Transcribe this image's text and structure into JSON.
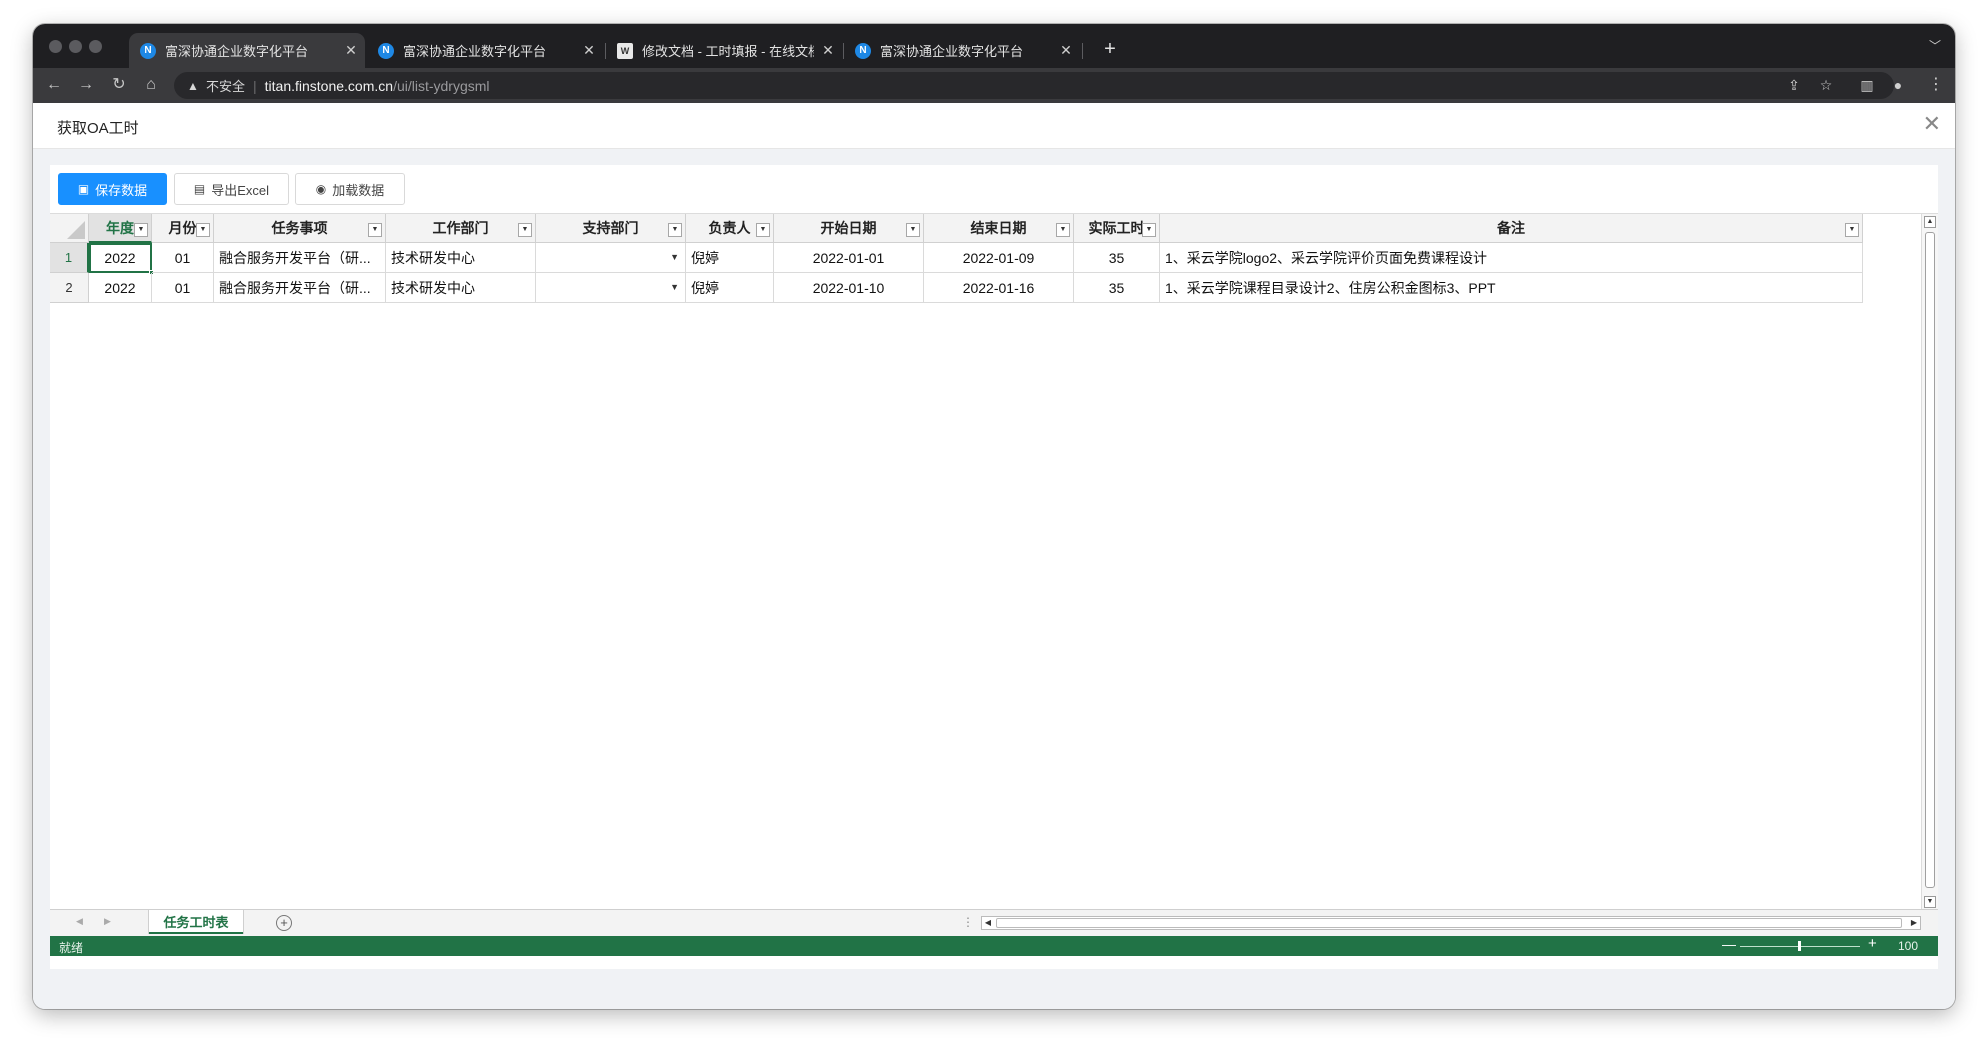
{
  "browser": {
    "tabs": [
      {
        "title": "富深协通企业数字化平台",
        "icon": "N",
        "active": true
      },
      {
        "title": "富深协通企业数字化平台",
        "icon": "N",
        "active": false
      },
      {
        "title": "修改文档 - 工时填报 - 在线文档编辑",
        "icon": "doc",
        "active": false
      },
      {
        "title": "富深协通企业数字化平台",
        "icon": "N",
        "active": false
      }
    ],
    "security_label": "不安全",
    "url_host": "titan.finstone.com.cn",
    "url_path": "/ui/list-ydrygsml"
  },
  "dialog": {
    "title": "获取OA工时"
  },
  "toolbar": {
    "save_label": "保存数据",
    "export_label": "导出Excel",
    "load_label": "加载数据"
  },
  "sheet": {
    "columns": [
      "年度",
      "月份",
      "任务事项",
      "工作部门",
      "支持部门",
      "负责人",
      "开始日期",
      "结束日期",
      "实际工时",
      "备注"
    ],
    "rows": [
      {
        "num": "1",
        "cells": [
          "2022",
          "01",
          "融合服务开发平台（研...",
          "技术研发中心",
          "",
          "倪婷",
          "2022-01-01",
          "2022-01-09",
          "35",
          "1、采云学院logo2、采云学院评价页面免费课程设计"
        ]
      },
      {
        "num": "2",
        "cells": [
          "2022",
          "01",
          "融合服务开发平台（研...",
          "技术研发中心",
          "",
          "倪婷",
          "2022-01-10",
          "2022-01-16",
          "35",
          "1、采云学院课程目录设计2、住房公积金图标3、PPT"
        ]
      }
    ],
    "sheet_tab": "任务工时表",
    "status": "就绪",
    "zoom": "100",
    "colors": {
      "accent": "#217346",
      "primary": "#1890ff"
    }
  }
}
